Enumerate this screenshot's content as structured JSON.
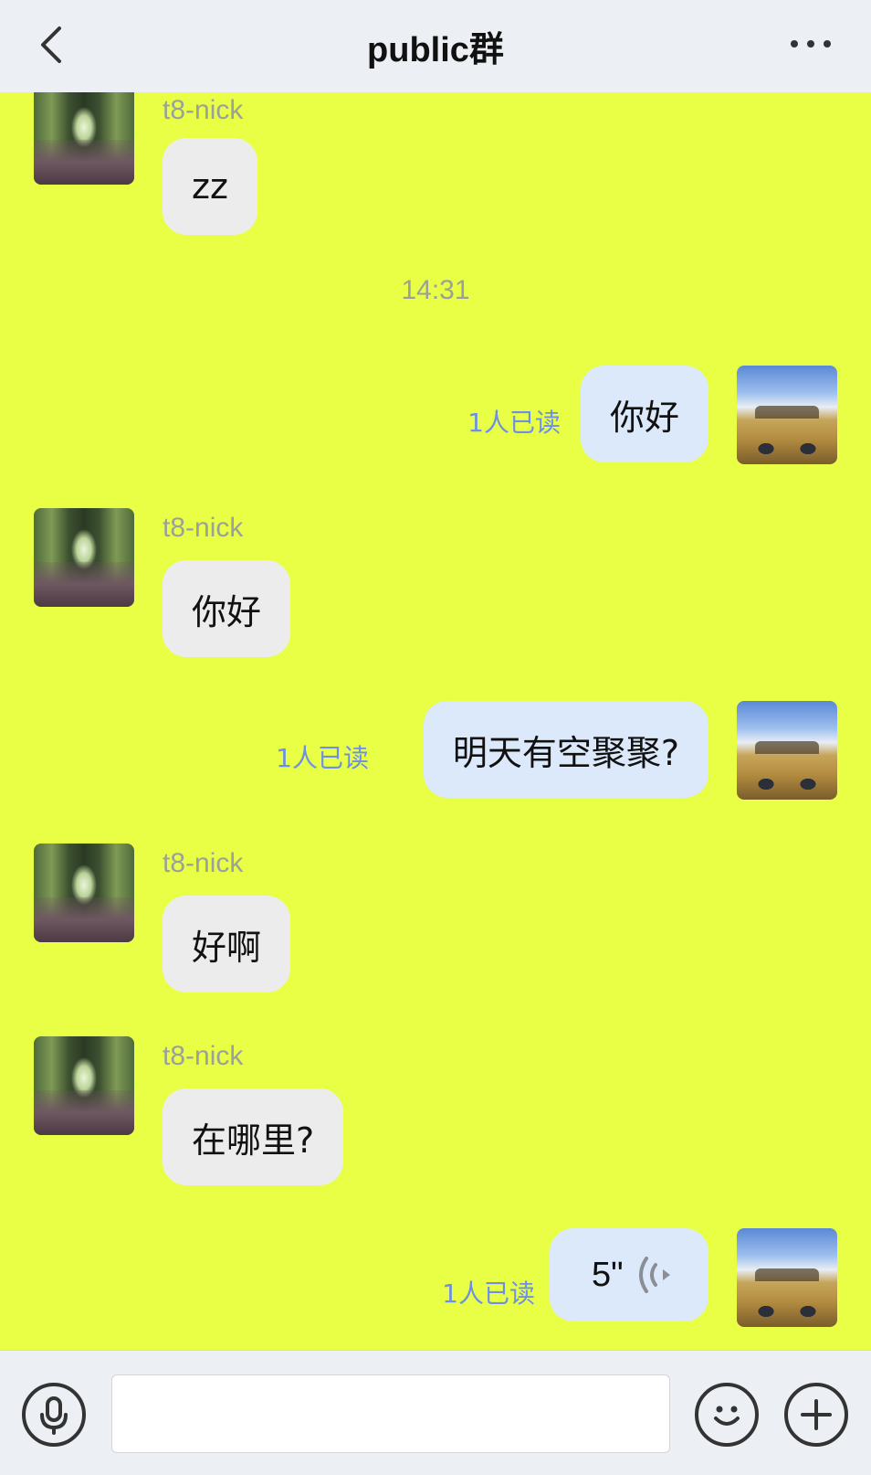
{
  "header": {
    "title": "public群",
    "back_icon": "chevron-left-icon",
    "more_icon": "more-dots-icon"
  },
  "timestamp": "14:31",
  "messages": [
    {
      "side": "in",
      "nick": "t8-nick",
      "text": "zz"
    },
    {
      "side": "out",
      "text": "你好",
      "read": "1人已读"
    },
    {
      "side": "in",
      "nick": "t8-nick",
      "text": "你好"
    },
    {
      "side": "out",
      "text": "明天有空聚聚?",
      "read": "1人已读"
    },
    {
      "side": "in",
      "nick": "t8-nick",
      "text": "好啊"
    },
    {
      "side": "in",
      "nick": "t8-nick",
      "text": "在哪里?"
    },
    {
      "side": "out",
      "voice_duration": "5\"",
      "read": "1人已读"
    }
  ],
  "footer": {
    "voice_icon": "microphone-icon",
    "input_value": "",
    "emoji_icon": "smiley-icon",
    "add_icon": "plus-circle-icon"
  },
  "colors": {
    "chat_background": "#E8FF46",
    "bar_background": "#ECEFF4",
    "incoming_bubble": "#ECECEC",
    "outgoing_bubble": "#DCE9FA",
    "read_receipt": "#6D8FE5",
    "nick_and_time": "#9BA09A"
  }
}
